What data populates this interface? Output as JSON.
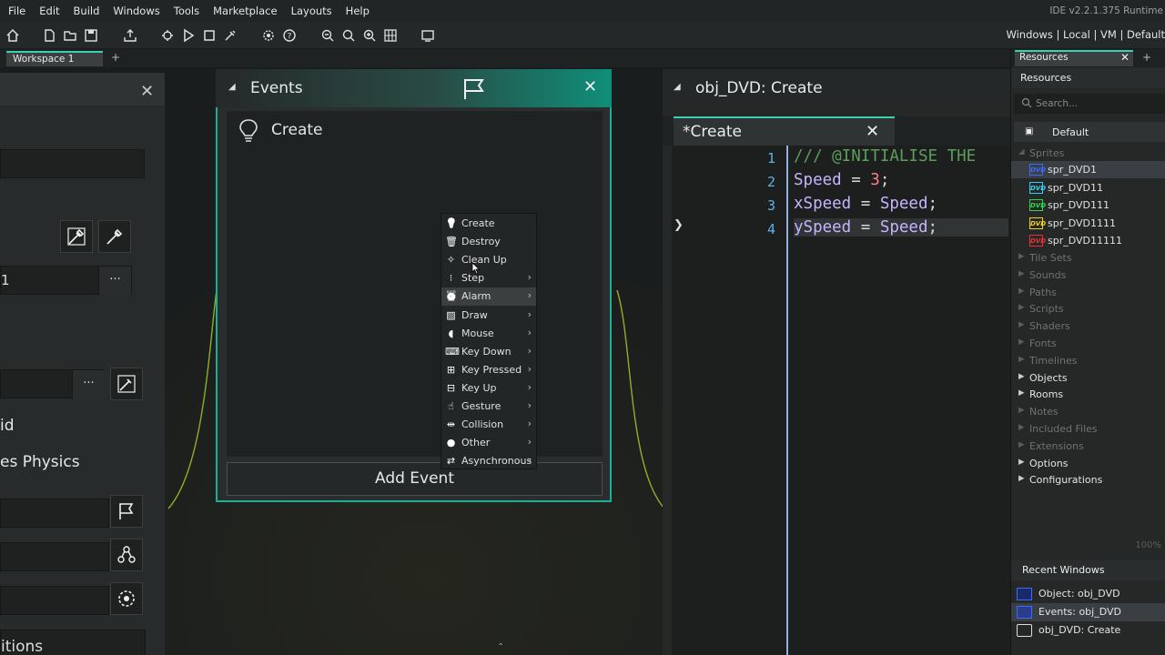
{
  "menu": {
    "items": [
      "File",
      "Edit",
      "Build",
      "Windows",
      "Tools",
      "Marketplace",
      "Layouts",
      "Help"
    ],
    "version": "IDE v2.2.1.375  Runtime"
  },
  "toolbar": {
    "target": "Windows | Local | VM | Default"
  },
  "workspace": {
    "tab": "Workspace 1",
    "plus": "+"
  },
  "object_panel": {
    "value_field": "1",
    "more": "···",
    "text1": "id",
    "text2": "es Physics",
    "text3": "itions"
  },
  "events": {
    "title": "Events",
    "list": [
      {
        "label": "Create"
      }
    ],
    "add_button": "Add Event"
  },
  "context_menu": {
    "items": [
      {
        "label": "Create",
        "icon": "lightbulb-icon",
        "submenu": false
      },
      {
        "label": "Destroy",
        "icon": "trash-icon",
        "submenu": false
      },
      {
        "label": "Clean Up",
        "icon": "broom-icon",
        "submenu": false
      },
      {
        "label": "Step",
        "icon": "footsteps-icon",
        "submenu": true
      },
      {
        "label": "Alarm",
        "icon": "alarm-clock-icon",
        "submenu": true,
        "highlighted": true
      },
      {
        "label": "Draw",
        "icon": "picture-icon",
        "submenu": true
      },
      {
        "label": "Mouse",
        "icon": "mouse-icon",
        "submenu": true
      },
      {
        "label": "Key Down",
        "icon": "keyboard-icon",
        "submenu": true
      },
      {
        "label": "Key Pressed",
        "icon": "keys-pressed-icon",
        "submenu": true
      },
      {
        "label": "Key Up",
        "icon": "keys-up-icon",
        "submenu": true
      },
      {
        "label": "Gesture",
        "icon": "hand-gesture-icon",
        "submenu": true
      },
      {
        "label": "Collision",
        "icon": "collision-arrows-icon",
        "submenu": true
      },
      {
        "label": "Other",
        "icon": "lightbulb-solid-icon",
        "submenu": true
      },
      {
        "label": "Asynchronous",
        "icon": "swap-arrows-icon",
        "submenu": true
      }
    ]
  },
  "code_editor": {
    "window_title": "obj_DVD: Create",
    "tab": "*Create",
    "lines": [
      {
        "n": "1",
        "tokens": [
          {
            "t": "/// @INITIALISE THE",
            "c": "cm"
          }
        ]
      },
      {
        "n": "2",
        "tokens": [
          {
            "t": "Speed",
            "c": "id"
          },
          {
            "t": " = ",
            "c": "op"
          },
          {
            "t": "3",
            "c": "num"
          },
          {
            "t": ";",
            "c": "op"
          }
        ]
      },
      {
        "n": "3",
        "tokens": [
          {
            "t": "xSpeed",
            "c": "id"
          },
          {
            "t": " = ",
            "c": "op"
          },
          {
            "t": "Speed",
            "c": "id"
          },
          {
            "t": ";",
            "c": "op"
          }
        ]
      },
      {
        "n": "4",
        "tokens": [
          {
            "t": "ySpeed",
            "c": "id"
          },
          {
            "t": " = ",
            "c": "op"
          },
          {
            "t": "Speed",
            "c": "id"
          },
          {
            "t": ";",
            "c": "op"
          }
        ]
      }
    ]
  },
  "resources": {
    "tab": "Resources",
    "title": "Resources",
    "search_placeholder": "Search...",
    "group": "Default",
    "sprites_label": "Sprites",
    "sprites": [
      {
        "name": "spr_DVD1",
        "color": "#3a6bff"
      },
      {
        "name": "spr_DVD11",
        "color": "#35d0f0"
      },
      {
        "name": "spr_DVD111",
        "color": "#2fd84a"
      },
      {
        "name": "spr_DVD1111",
        "color": "#f0d020"
      },
      {
        "name": "spr_DVD11111",
        "color": "#e83030"
      }
    ],
    "folders": [
      {
        "label": "Tile Sets",
        "dim": true
      },
      {
        "label": "Sounds",
        "dim": true
      },
      {
        "label": "Paths",
        "dim": true
      },
      {
        "label": "Scripts",
        "dim": true
      },
      {
        "label": "Shaders",
        "dim": true
      },
      {
        "label": "Fonts",
        "dim": true
      },
      {
        "label": "Timelines",
        "dim": true
      },
      {
        "label": "Objects",
        "dim": false
      },
      {
        "label": "Rooms",
        "dim": false
      },
      {
        "label": "Notes",
        "dim": true
      },
      {
        "label": "Included Files",
        "dim": true
      },
      {
        "label": "Extensions",
        "dim": true
      },
      {
        "label": "Options",
        "dim": false
      },
      {
        "label": "Configurations",
        "dim": false
      }
    ],
    "zoom": "100%",
    "recent_title": "Recent Windows",
    "recent": [
      {
        "label": "Object: obj_DVD",
        "icon": "object-icon"
      },
      {
        "label": "Events: obj_DVD",
        "icon": "sprite-icon"
      },
      {
        "label": "obj_DVD: Create",
        "icon": "code-icon"
      }
    ]
  }
}
